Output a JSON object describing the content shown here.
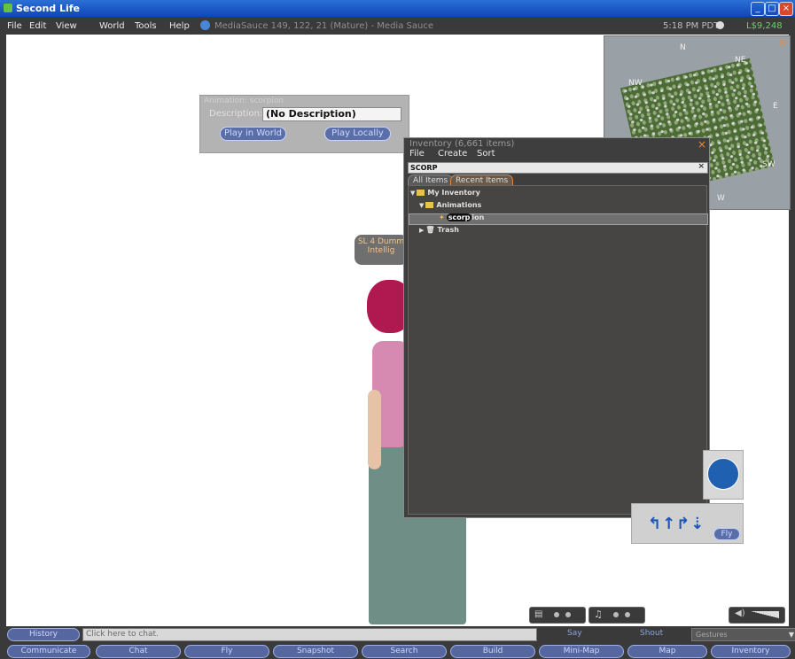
{
  "window": {
    "title": "Second Life",
    "controls": [
      "minimize",
      "maximize",
      "close"
    ]
  },
  "menubar": {
    "items": [
      "File",
      "Edit",
      "View",
      "World",
      "Tools",
      "Help"
    ],
    "location": "MediaSauce 149, 122, 21 (Mature) - Media Sauce",
    "time": "5:18 PM PDT",
    "balance": "L$9,248"
  },
  "anim_preview": {
    "header": "Animation: scorpion",
    "description_label": "Description:",
    "description_value": "(No Description)",
    "play_inworld": "Play in World",
    "play_locally": "Play Locally"
  },
  "tooltip": {
    "line1": "SL 4 Dumm",
    "line2": "Intellig"
  },
  "inventory": {
    "title": "Inventory (6,661 items)",
    "menu": [
      "File",
      "Create",
      "Sort"
    ],
    "search_value": "SCORP",
    "tabs": [
      "All Items",
      "Recent Items"
    ],
    "tree": {
      "root": "My Inventory",
      "folder": "Animations",
      "item_match": "scorp",
      "item_rest": "ion",
      "trash": "Trash"
    }
  },
  "minimap": {
    "north": "N",
    "ne": "NE",
    "nw": "NW",
    "east": "E",
    "sw": "SW",
    "west": "W"
  },
  "chat": {
    "history_button": "History",
    "input_placeholder": "Click here to chat.",
    "say": "Say",
    "shout": "Shout",
    "gestures": "Gestures"
  },
  "toolbar": {
    "buttons": [
      "Communicate",
      "Chat",
      "Fly",
      "Snapshot",
      "Search",
      "Build",
      "Mini-Map",
      "Map",
      "Inventory"
    ]
  },
  "movement": {
    "fly_label": "Fly"
  },
  "colors": {
    "titlebar": "#1f5cc9",
    "accent_orange": "#e88a3a",
    "button_blue": "#5667a0",
    "balance_green": "#6bd06b"
  }
}
